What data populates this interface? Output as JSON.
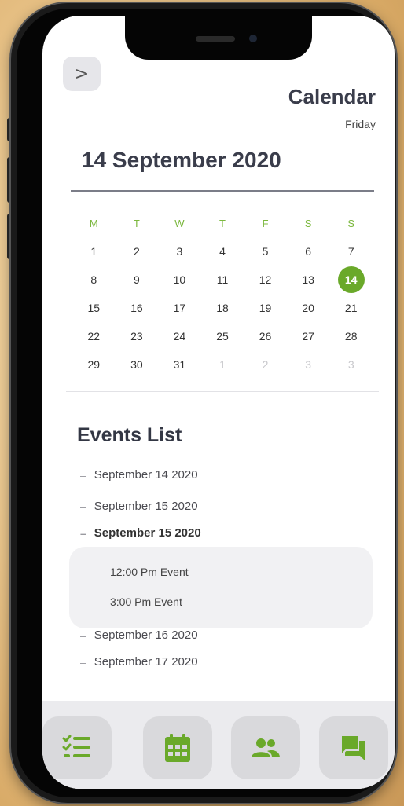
{
  "header": {
    "back_glyph": ">",
    "title": "Calendar",
    "weekday": "Friday",
    "date": "14 September 2020"
  },
  "calendar": {
    "weekdays": [
      "M",
      "T",
      "W",
      "T",
      "F",
      "S",
      "S"
    ],
    "weeks": [
      [
        "1",
        "2",
        "3",
        "4",
        "5",
        "6",
        "7"
      ],
      [
        "8",
        "9",
        "10",
        "11",
        "12",
        "13",
        "14"
      ],
      [
        "15",
        "16",
        "17",
        "18",
        "19",
        "20",
        "21"
      ],
      [
        "22",
        "23",
        "24",
        "25",
        "26",
        "27",
        "28"
      ],
      [
        "29",
        "30",
        "31",
        "1",
        "2",
        "3",
        "3"
      ]
    ],
    "selected_day": "14",
    "accent_color": "#6aa92a"
  },
  "events": {
    "title": "Events List",
    "items": [
      {
        "label": "September 14 2020"
      },
      {
        "label": "September 15 2020"
      },
      {
        "label": "September 15 2020",
        "expanded": true,
        "sub_items": [
          "12:00 Pm Event",
          "3:00 Pm Event"
        ]
      },
      {
        "label": "September 16 2020"
      },
      {
        "label": "September 17 2020"
      }
    ]
  },
  "tabbar": {
    "tabs": [
      {
        "icon": "checklist-icon"
      },
      {
        "icon": "calendar-icon"
      },
      {
        "icon": "people-icon"
      },
      {
        "icon": "chat-icon"
      }
    ],
    "icon_color": "#6aa92a"
  }
}
